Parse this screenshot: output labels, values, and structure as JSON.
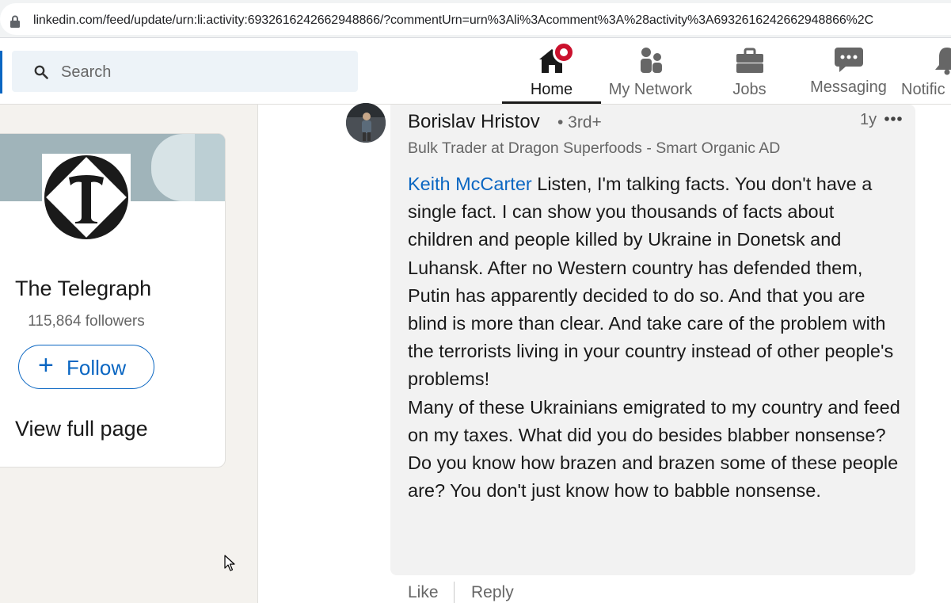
{
  "browser": {
    "url": "linkedin.com/feed/update/urn:li:activity:6932616242662948866/?commentUrn=urn%3Ali%3Acomment%3A%28activity%3A6932616242662948866%2C"
  },
  "nav": {
    "search_placeholder": "Search",
    "items": [
      {
        "label": "Home",
        "icon": "home-icon"
      },
      {
        "label": "My Network",
        "icon": "people-icon"
      },
      {
        "label": "Jobs",
        "icon": "briefcase-icon"
      },
      {
        "label": "Messaging",
        "icon": "chat-icon"
      },
      {
        "label": "Notific",
        "icon": "bell-icon"
      }
    ]
  },
  "company_card": {
    "name": "The Telegraph",
    "followers": "115,864 followers",
    "follow_label": "Follow",
    "view_full_page": "View full page"
  },
  "comment": {
    "author": "Borislav Hristov",
    "degree": "• 3rd+",
    "headline": "Bulk Trader at Dragon Superfoods - Smart Organic AD",
    "time_ago": "1y",
    "mention": "Keith McCarter",
    "paragraph_1": " Listen, I'm talking facts. You don't have a single fact. I can show you thousands of facts about children and people killed by Ukraine in Donetsk and Luhansk. After no Western country has defended them, Putin has apparently decided to do so. And that you are blind is more than clear. And take care of the problem with the terrorists living in your country instead of other people's problems!",
    "paragraph_2": "Many of these Ukrainians emigrated to my country and feed on my taxes. What did you do besides blabber nonsense?",
    "paragraph_3": "Do you know how brazen and brazen some of these people are? You don't just know how to babble nonsense.",
    "like_label": "Like",
    "reply_label": "Reply"
  },
  "colors": {
    "brand_blue": "#0a66c2",
    "notification_red": "#cb112d",
    "page_background": "#f4f2ee"
  }
}
